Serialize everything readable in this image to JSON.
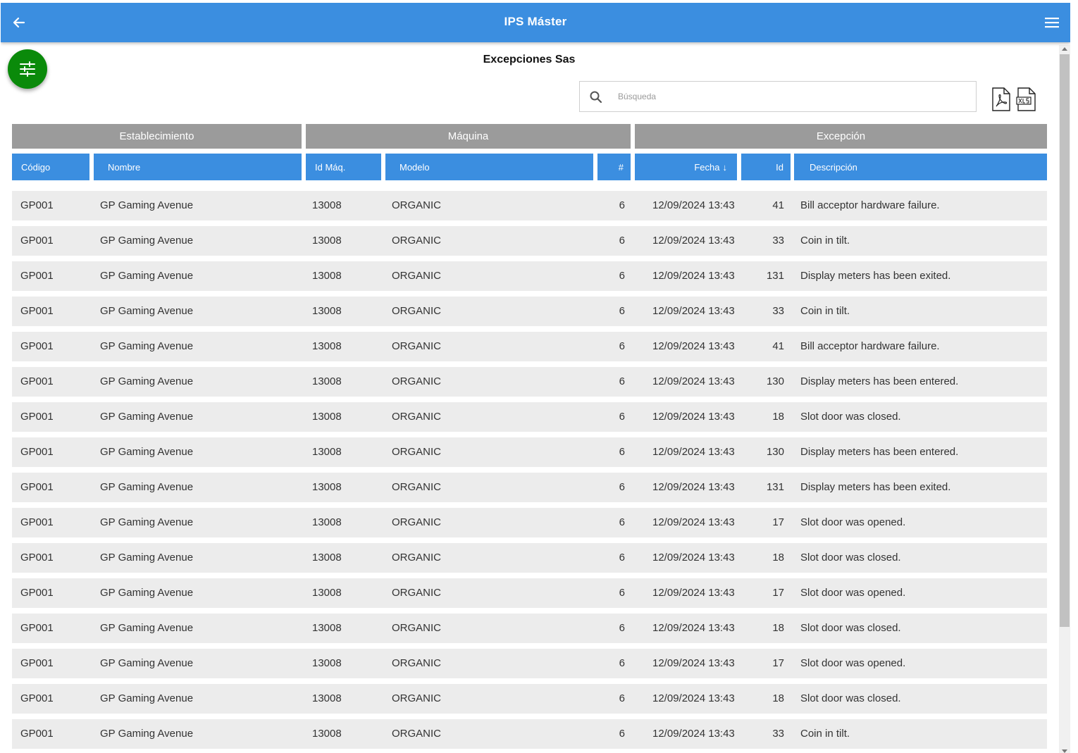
{
  "header": {
    "title": "IPS Máster",
    "back_icon": "arrow-left-icon",
    "menu_icon": "hamburger-menu-icon",
    "color": "#3b8ee0"
  },
  "filter_button": {
    "icon": "sliders-icon",
    "color": "#0a8a0a"
  },
  "page_title": "Excepciones Sas",
  "search": {
    "placeholder": "Búsqueda",
    "value": ""
  },
  "exports": [
    {
      "icon": "pdf-file-icon"
    },
    {
      "icon": "xls-file-icon"
    }
  ],
  "table": {
    "groups": [
      "Establecimiento",
      "Máquina",
      "Excepción"
    ],
    "columns": [
      "Código",
      "Nombre",
      "Id Máq.",
      "Modelo",
      "#",
      "Fecha",
      "Id",
      "Descripción"
    ],
    "sort_indicator": "↓",
    "rows": [
      [
        "GP001",
        "GP Gaming Avenue",
        "13008",
        "ORGANIC",
        "6",
        "12/09/2024 13:43",
        "41",
        "Bill acceptor hardware failure."
      ],
      [
        "GP001",
        "GP Gaming Avenue",
        "13008",
        "ORGANIC",
        "6",
        "12/09/2024 13:43",
        "33",
        "Coin in tilt."
      ],
      [
        "GP001",
        "GP Gaming Avenue",
        "13008",
        "ORGANIC",
        "6",
        "12/09/2024 13:43",
        "131",
        "Display meters has been exited."
      ],
      [
        "GP001",
        "GP Gaming Avenue",
        "13008",
        "ORGANIC",
        "6",
        "12/09/2024 13:43",
        "33",
        "Coin in tilt."
      ],
      [
        "GP001",
        "GP Gaming Avenue",
        "13008",
        "ORGANIC",
        "6",
        "12/09/2024 13:43",
        "41",
        "Bill acceptor hardware failure."
      ],
      [
        "GP001",
        "GP Gaming Avenue",
        "13008",
        "ORGANIC",
        "6",
        "12/09/2024 13:43",
        "130",
        "Display meters has been entered."
      ],
      [
        "GP001",
        "GP Gaming Avenue",
        "13008",
        "ORGANIC",
        "6",
        "12/09/2024 13:43",
        "18",
        "Slot door was closed."
      ],
      [
        "GP001",
        "GP Gaming Avenue",
        "13008",
        "ORGANIC",
        "6",
        "12/09/2024 13:43",
        "130",
        "Display meters has been entered."
      ],
      [
        "GP001",
        "GP Gaming Avenue",
        "13008",
        "ORGANIC",
        "6",
        "12/09/2024 13:43",
        "131",
        "Display meters has been exited."
      ],
      [
        "GP001",
        "GP Gaming Avenue",
        "13008",
        "ORGANIC",
        "6",
        "12/09/2024 13:43",
        "17",
        "Slot door was opened."
      ],
      [
        "GP001",
        "GP Gaming Avenue",
        "13008",
        "ORGANIC",
        "6",
        "12/09/2024 13:43",
        "18",
        "Slot door was closed."
      ],
      [
        "GP001",
        "GP Gaming Avenue",
        "13008",
        "ORGANIC",
        "6",
        "12/09/2024 13:43",
        "17",
        "Slot door was opened."
      ],
      [
        "GP001",
        "GP Gaming Avenue",
        "13008",
        "ORGANIC",
        "6",
        "12/09/2024 13:43",
        "18",
        "Slot door was closed."
      ],
      [
        "GP001",
        "GP Gaming Avenue",
        "13008",
        "ORGANIC",
        "6",
        "12/09/2024 13:43",
        "17",
        "Slot door was opened."
      ],
      [
        "GP001",
        "GP Gaming Avenue",
        "13008",
        "ORGANIC",
        "6",
        "12/09/2024 13:43",
        "18",
        "Slot door was closed."
      ],
      [
        "GP001",
        "GP Gaming Avenue",
        "13008",
        "ORGANIC",
        "6",
        "12/09/2024 13:43",
        "33",
        "Coin in tilt."
      ]
    ]
  }
}
